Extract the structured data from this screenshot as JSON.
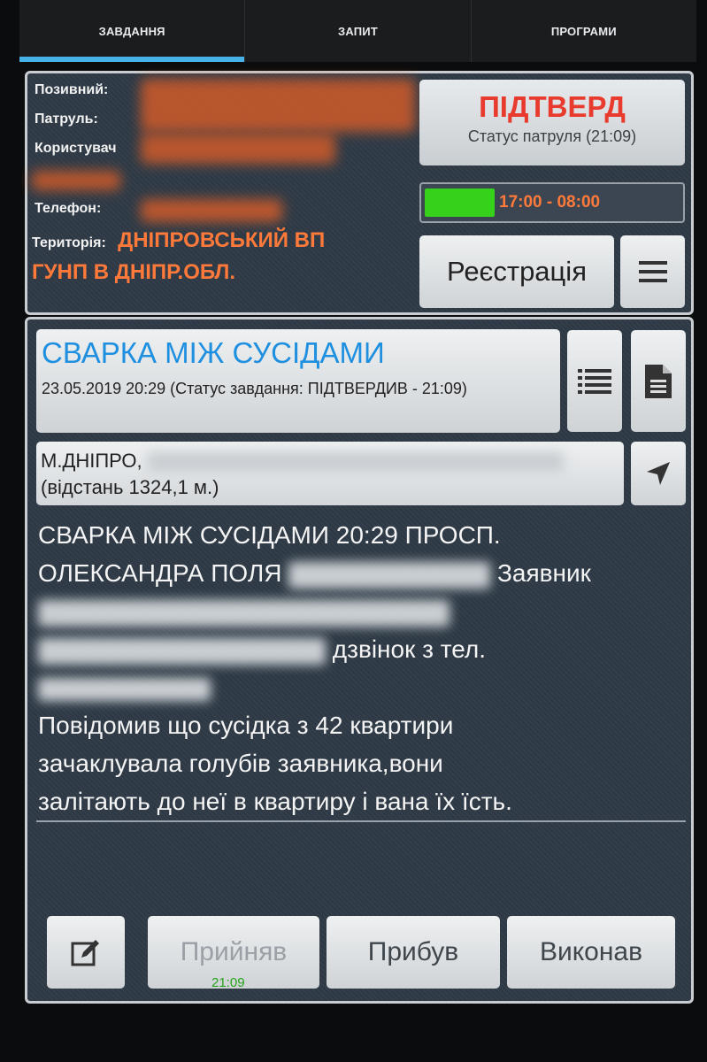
{
  "tabs": [
    "ЗАВДАННЯ",
    "ЗАПИТ",
    "ПРОГРАМИ"
  ],
  "info": {
    "callsign_label": "Позивний:",
    "patrol_label": "Патруль:",
    "user_label": "Користувач",
    "phone_label": "Телефон:",
    "territory_label": "Територія:",
    "territory_value_line1": "ДНІПРОВСЬКИЙ ВП",
    "territory_value_line2": "ГУНП В ДНІПР.ОБЛ."
  },
  "patrol_status": {
    "title": "ПІДТВЕРД",
    "subtitle": "Статус патруля (21:09)"
  },
  "shift": {
    "text": "17:00 - 08:00",
    "progress": 0.27
  },
  "register_button": "Реєстрація",
  "task": {
    "title": "СВАРКА МІЖ СУСІДАМИ",
    "date_status": "23.05.2019 20:29 (Статус завдання: ПІДТВЕРДИВ - 21:09)",
    "address_line1": "М.ДНІПРО,",
    "address_line2": "(відстань 1324,1 м.)",
    "desc_line1": "СВАРКА МІЖ СУСІДАМИ 20:29 ПРОСП.",
    "desc_line2a": "ОЛЕКСАНДРА ПОЛЯ",
    "desc_line2b": "Заявник",
    "desc_line4": "дзвінок з тел.",
    "desc_line6": "Повідомив що сусідка з 42 квартири",
    "desc_line7": "зачаклувала голубів заявника,вони",
    "desc_line8": "залітають до неї в квартиру і вана їх їсть."
  },
  "actions": {
    "accepted": "Прийняв",
    "accepted_time": "21:09",
    "arrived": "Прибув",
    "done": "Виконав"
  },
  "colors": {
    "accent_tab": "#47b2e8",
    "status_red": "#e83b2e",
    "orange_text": "#ff7a3a",
    "progress_green": "#36d11b",
    "title_blue": "#1f8fe0"
  }
}
